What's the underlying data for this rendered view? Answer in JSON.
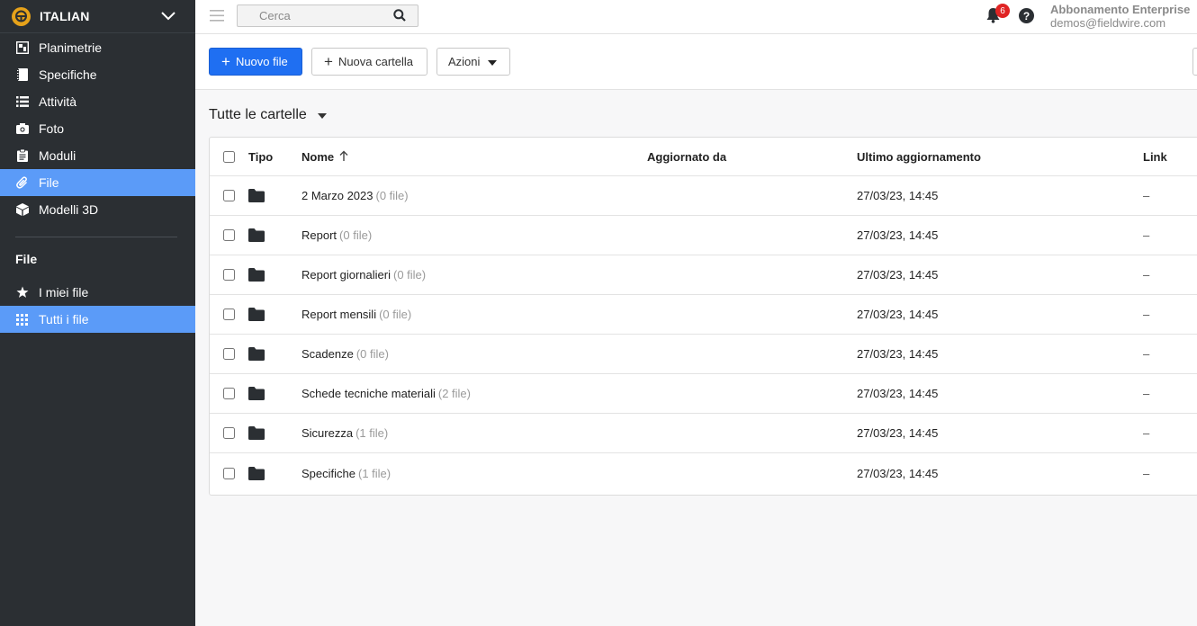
{
  "project": {
    "name": "ITALIAN"
  },
  "nav": {
    "items": [
      {
        "label": "Planimetrie",
        "icon": "floorplan-icon"
      },
      {
        "label": "Specifiche",
        "icon": "specs-book-icon"
      },
      {
        "label": "Attività",
        "icon": "list-icon"
      },
      {
        "label": "Foto",
        "icon": "camera-icon"
      },
      {
        "label": "Moduli",
        "icon": "clipboard-icon"
      },
      {
        "label": "File",
        "icon": "paperclip-icon",
        "active": true
      },
      {
        "label": "Modelli 3D",
        "icon": "cube-icon"
      }
    ],
    "section_title": "File",
    "section_items": [
      {
        "label": "I miei file",
        "icon": "star-icon"
      },
      {
        "label": "Tutti i file",
        "icon": "grid-icon",
        "active": true
      }
    ]
  },
  "topbar": {
    "search_placeholder": "Cerca",
    "notification_count": "6",
    "help_label": "?",
    "account_plan": "Abbonamento Enterprise",
    "account_email": "demos@fieldwire.com"
  },
  "toolbar": {
    "new_file_label": "Nuovo file",
    "new_folder_label": "Nuova cartella",
    "actions_label": "Azioni"
  },
  "folder_view": {
    "title": "Tutte le cartelle"
  },
  "table": {
    "columns": {
      "type": "Tipo",
      "name": "Nome",
      "updated_by": "Aggiornato da",
      "last_updated": "Ultimo aggiornamento",
      "link": "Link"
    },
    "rows": [
      {
        "name": "2 Marzo 2023",
        "count": "(0 file)",
        "updated_by": "",
        "date": "27/03/23, 14:45",
        "link": "–"
      },
      {
        "name": "Report",
        "count": "(0 file)",
        "updated_by": "",
        "date": "27/03/23, 14:45",
        "link": "–"
      },
      {
        "name": "Report giornalieri",
        "count": "(0 file)",
        "updated_by": "",
        "date": "27/03/23, 14:45",
        "link": "–"
      },
      {
        "name": "Report mensili",
        "count": "(0 file)",
        "updated_by": "",
        "date": "27/03/23, 14:45",
        "link": "–"
      },
      {
        "name": "Scadenze",
        "count": "(0 file)",
        "updated_by": "",
        "date": "27/03/23, 14:45",
        "link": "–"
      },
      {
        "name": "Schede tecniche materiali",
        "count": "(2 file)",
        "updated_by": "",
        "date": "27/03/23, 14:45",
        "link": "–"
      },
      {
        "name": "Sicurezza",
        "count": "(1 file)",
        "updated_by": "",
        "date": "27/03/23, 14:45",
        "link": "–"
      },
      {
        "name": "Specifiche",
        "count": "(1 file)",
        "updated_by": "",
        "date": "27/03/23, 14:45",
        "link": "–"
      }
    ]
  }
}
